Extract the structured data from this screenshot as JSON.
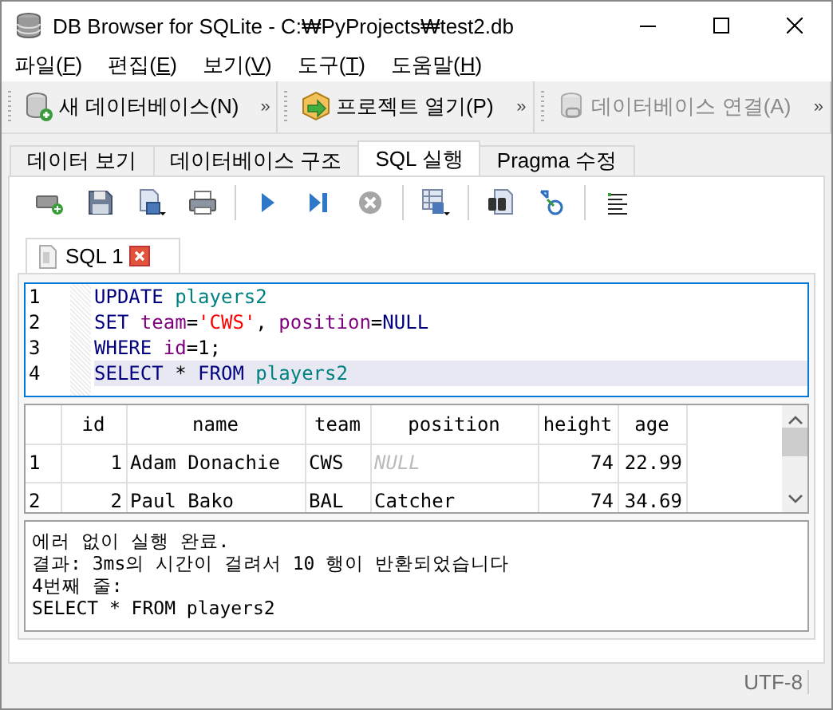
{
  "window": {
    "title": "DB Browser for SQLite - C:₩PyProjects₩test2.db"
  },
  "menu": [
    "파일(F)",
    "편집(E)",
    "보기(V)",
    "도구(T)",
    "도움말(H)"
  ],
  "main_toolbar": [
    {
      "kind": "new-database",
      "label": "새 데이터베이스(N)",
      "disabled": false,
      "overflow": "»"
    },
    {
      "kind": "open-project",
      "label": "프로젝트 열기(P)",
      "disabled": false,
      "overflow": "»"
    },
    {
      "kind": "attach-database",
      "label": "데이터베이스 연결(A)",
      "disabled": true,
      "overflow": "»"
    }
  ],
  "tabs": [
    {
      "label": "데이터 보기",
      "selected": false
    },
    {
      "label": "데이터베이스 구조",
      "selected": false
    },
    {
      "label": "SQL 실행",
      "selected": true
    },
    {
      "label": "Pragma 수정",
      "selected": false
    }
  ],
  "editor_tabs": [
    {
      "label": "SQL 1",
      "selected": true
    }
  ],
  "editor": {
    "lines": [
      {
        "number": "1",
        "current": false,
        "tokens": [
          {
            "text": "UPDATE",
            "kind": "keyword"
          },
          {
            "text": " players2",
            "kind": "table"
          }
        ]
      },
      {
        "number": "2",
        "current": false,
        "tokens": [
          {
            "text": "SET",
            "kind": "keyword"
          },
          {
            "text": " team",
            "kind": "column"
          },
          {
            "text": "=",
            "kind": "plain"
          },
          {
            "text": "'CWS'",
            "kind": "string"
          },
          {
            "text": ", ",
            "kind": "plain"
          },
          {
            "text": "position",
            "kind": "column"
          },
          {
            "text": "=",
            "kind": "plain"
          },
          {
            "text": "NULL",
            "kind": "keyword"
          }
        ]
      },
      {
        "number": "3",
        "current": false,
        "tokens": [
          {
            "text": "WHERE",
            "kind": "keyword"
          },
          {
            "text": " id",
            "kind": "column"
          },
          {
            "text": "=1;",
            "kind": "plain"
          }
        ]
      },
      {
        "number": "4",
        "current": true,
        "tokens": [
          {
            "text": "SELECT",
            "kind": "keyword"
          },
          {
            "text": " * ",
            "kind": "plain"
          },
          {
            "text": "FROM",
            "kind": "keyword"
          },
          {
            "text": " players2",
            "kind": "table"
          }
        ]
      }
    ]
  },
  "results": {
    "columns": [
      "id",
      "name",
      "team",
      "position",
      "height",
      "age"
    ],
    "rows": [
      {
        "number": "1",
        "cells": [
          {
            "text": "1",
            "kind": "number"
          },
          {
            "text": "Adam Donachie",
            "kind": "text"
          },
          {
            "text": "CWS",
            "kind": "text"
          },
          {
            "text": "NULL",
            "kind": "null"
          },
          {
            "text": "74",
            "kind": "number"
          },
          {
            "text": "22.99",
            "kind": "number"
          }
        ]
      },
      {
        "number": "2",
        "cells": [
          {
            "text": "2",
            "kind": "number"
          },
          {
            "text": "Paul Bako",
            "kind": "text"
          },
          {
            "text": "BAL",
            "kind": "text"
          },
          {
            "text": "Catcher",
            "kind": "text"
          },
          {
            "text": "74",
            "kind": "number"
          },
          {
            "text": "34.69",
            "kind": "number"
          }
        ]
      }
    ]
  },
  "messages": [
    "에러 없이 실행 완료.",
    "결과: 3ms의 시간이 걸려서 10 행이 반환되었습니다",
    "4번째 줄:",
    "SELECT * FROM players2"
  ],
  "status_bar": {
    "encoding": "UTF-8"
  }
}
